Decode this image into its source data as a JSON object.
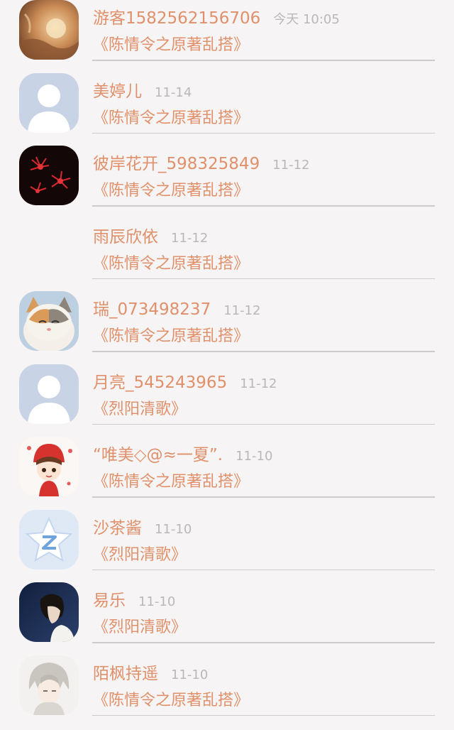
{
  "messages": [
    {
      "name": "游客1582562156706",
      "time": "今天 10:05",
      "book": "《陈情令之原著乱搭》",
      "avatar_icon": "landscape-avatar-icon"
    },
    {
      "name": "美婷儿",
      "time": "11-14",
      "book": "《陈情令之原著乱搭》",
      "avatar_icon": "default-person-avatar-icon"
    },
    {
      "name": "彼岸花开_598325849",
      "time": "11-12",
      "book": "《陈情令之原著乱搭》",
      "avatar_icon": "red-spider-lily-avatar-icon"
    },
    {
      "name": "雨辰欣依",
      "time": "11-12",
      "book": "《陈情令之原著乱搭》",
      "avatar_icon": ""
    },
    {
      "name": "瑞_073498237",
      "time": "11-12",
      "book": "《陈情令之原著乱搭》",
      "avatar_icon": "cat-avatar-icon"
    },
    {
      "name": "月亮_545243965",
      "time": "11-12",
      "book": "《烈阳清歌》",
      "avatar_icon": "default-person-avatar-icon"
    },
    {
      "name": "“唯美◇@≈一夏”.",
      "time": "11-10",
      "book": "《陈情令之原著乱搭》",
      "avatar_icon": "cartoon-girl-avatar-icon"
    },
    {
      "name": "沙茶酱",
      "time": "11-10",
      "book": "《烈阳清歌》",
      "avatar_icon": "qq-star-avatar-icon"
    },
    {
      "name": "易乐",
      "time": "11-10",
      "book": "《烈阳清歌》",
      "avatar_icon": "dark-portrait-avatar-icon"
    },
    {
      "name": "陌枫持遥",
      "time": "11-10",
      "book": "《陈情令之原著乱搭》",
      "avatar_icon": "anime-boy-avatar-icon"
    }
  ],
  "colors": {
    "accent": "#e0906a",
    "muted": "#b8b8b8",
    "divider": "#cfcbcc",
    "background": "#f7f4f5"
  }
}
